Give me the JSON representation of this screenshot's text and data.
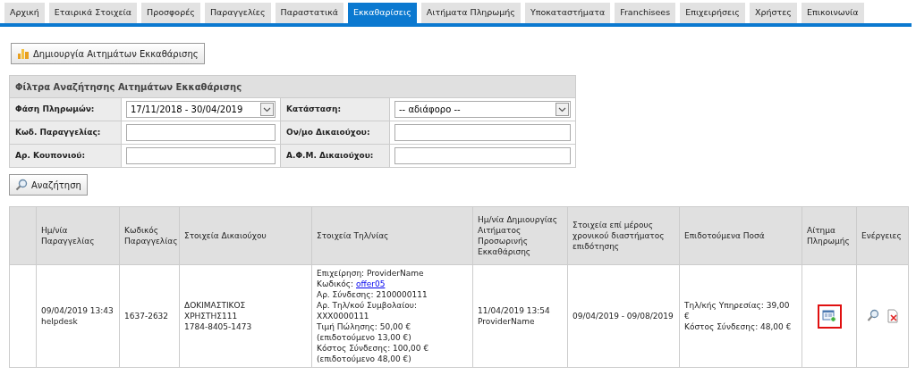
{
  "tabs": [
    {
      "label": "Αρχική",
      "selected": false
    },
    {
      "label": "Εταιρικά Στοιχεία",
      "selected": false
    },
    {
      "label": "Προσφορές",
      "selected": false
    },
    {
      "label": "Παραγγελίες",
      "selected": false
    },
    {
      "label": "Παραστατικά",
      "selected": false
    },
    {
      "label": "Εκκαθαρίσεις",
      "selected": true
    },
    {
      "label": "Αιτήματα Πληρωμής",
      "selected": false
    },
    {
      "label": "Υποκαταστήματα",
      "selected": false
    },
    {
      "label": "Franchisees",
      "selected": false
    },
    {
      "label": "Επιχειρήσεις",
      "selected": false
    },
    {
      "label": "Χρήστες",
      "selected": false
    },
    {
      "label": "Επικοινωνία",
      "selected": false
    }
  ],
  "create_button": {
    "label": "Δημιουργία Αιτημάτων Εκκαθάρισης"
  },
  "filters": {
    "title": "Φίλτρα Αναζήτησης Αιτημάτων Εκκαθάρισης",
    "fields": [
      {
        "label": "Φάση Πληρωμών:",
        "kind": "select",
        "value": "17/11/2018 - 30/04/2019"
      },
      {
        "label": "Κατάσταση:",
        "kind": "select",
        "value": "-- αδιάφορο --"
      },
      {
        "label": "Κωδ. Παραγγελίας:",
        "kind": "text"
      },
      {
        "label": "Ον/μο Δικαιούχου:",
        "kind": "text"
      },
      {
        "label": "Αρ. Κουπονιού:",
        "kind": "text"
      },
      {
        "label": "Α.Φ.Μ. Δικαιούχου:",
        "kind": "text"
      }
    ],
    "search_button": {
      "label": "Αναζήτηση"
    }
  },
  "table": {
    "columns": [
      "Ημ/νία Παραγγελίας",
      "Κωδικός Παραγγελίας",
      "Στοιχεία Δικαιούχου",
      "Στοιχεία Τηλ/νίας",
      "Ημ/νία Δημιουργίας Αιτήματος Προσωρινής Εκκαθάρισης",
      "Στοιχεία επί μέρους χρονικού διαστήματος επιδότησης",
      "Επιδοτούμενα Ποσά",
      "Αίτημα Πληρωμής",
      "Ενέργειες"
    ],
    "rows": [
      {
        "order_date": [
          "09/04/2019 13:43",
          "helpdesk"
        ],
        "order_code": "1637-2632",
        "beneficiary": [
          "ΔΟΚΙΜΑΣΤΙΚΟΣ",
          "ΧΡΗΣΤΗΣ111",
          "1784-8405-1473"
        ],
        "telecom": [
          {
            "text": "Επιχείρηση: ProviderName"
          },
          {
            "text": "Κωδικός:",
            "link": "offer05"
          },
          {
            "text": "Αρ. Σύνδεσης: 2100000111"
          },
          {
            "text": "Αρ. Τηλ/κού Συμβολαίου: XXX0000111"
          },
          {
            "text": "Τιμή Πώλησης: 50,00 € (επιδοτούμενο 13,00 €)"
          },
          {
            "text": "Κόστος Σύνδεσης: 100,00 € (επιδοτούμενο 48,00 €)"
          }
        ],
        "created": [
          "11/04/2019 13:54",
          "ProviderName"
        ],
        "period": "09/04/2019 - 09/08/2019",
        "amounts": [
          "Τηλ/κής Υπηρεσίας: 39,00 €",
          "Κόστος Σύνδεσης: 48,00 €"
        ],
        "payment_highlighted": true
      }
    ]
  }
}
